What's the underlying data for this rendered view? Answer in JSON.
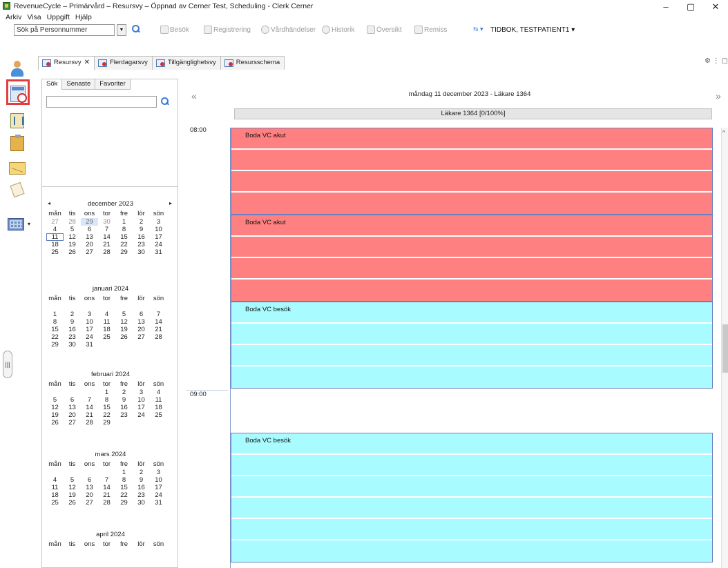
{
  "window": {
    "title": "RevenueCycle – Primärvård – Resursvy – Öppnad av Cerner Test, Scheduling - Clerk Cerner",
    "minimize": "–",
    "maximize": "▢",
    "close": "✕"
  },
  "menu": [
    "Arkiv",
    "Visa",
    "Uppgift",
    "Hjälp"
  ],
  "toolbar": {
    "search_placeholder": "Sök på Personnummer",
    "items": [
      "Besök",
      "Registrering",
      "Vårdhändelser",
      "Historik",
      "Översikt",
      "Remiss"
    ],
    "patient": "TIDBOK, TESTPATIENT1"
  },
  "tabs": [
    {
      "label": "Resursvy",
      "close": "✕"
    },
    {
      "label": "Flerdagarsvy"
    },
    {
      "label": "Tillgänglighetsvy"
    },
    {
      "label": "Resursschema"
    }
  ],
  "left_panel": {
    "subtabs": [
      "Sök",
      "Senaste",
      "Favoriter"
    ]
  },
  "calendar": {
    "weekdays": [
      "mån",
      "tis",
      "ons",
      "tor",
      "fre",
      "lör",
      "sön"
    ],
    "months": [
      {
        "title": "december 2023",
        "weeks": [
          [
            "27",
            "28",
            "29",
            "30",
            "1",
            "2",
            "3"
          ],
          [
            "4",
            "5",
            "6",
            "7",
            "8",
            "9",
            "10"
          ],
          [
            "11",
            "12",
            "13",
            "14",
            "15",
            "16",
            "17"
          ],
          [
            "18",
            "19",
            "20",
            "21",
            "22",
            "23",
            "24"
          ],
          [
            "25",
            "26",
            "27",
            "28",
            "29",
            "30",
            "31"
          ]
        ]
      },
      {
        "title": "januari 2024",
        "weeks": [
          [
            "",
            "",
            "",
            "",
            "",
            "",
            ""
          ],
          [
            "1",
            "2",
            "3",
            "4",
            "5",
            "6",
            "7"
          ],
          [
            "8",
            "9",
            "10",
            "11",
            "12",
            "13",
            "14"
          ],
          [
            "15",
            "16",
            "17",
            "18",
            "19",
            "20",
            "21"
          ],
          [
            "22",
            "23",
            "24",
            "25",
            "26",
            "27",
            "28"
          ],
          [
            "29",
            "30",
            "31",
            "",
            "",
            "",
            ""
          ]
        ]
      },
      {
        "title": "februari 2024",
        "weeks": [
          [
            "",
            "",
            "",
            "1",
            "2",
            "3",
            "4"
          ],
          [
            "5",
            "6",
            "7",
            "8",
            "9",
            "10",
            "11"
          ],
          [
            "12",
            "13",
            "14",
            "15",
            "16",
            "17",
            "18"
          ],
          [
            "19",
            "20",
            "21",
            "22",
            "23",
            "24",
            "25"
          ],
          [
            "26",
            "27",
            "28",
            "29",
            "",
            "",
            ""
          ]
        ]
      },
      {
        "title": "mars 2024",
        "weeks": [
          [
            "",
            "",
            "",
            "",
            "1",
            "2",
            "3"
          ],
          [
            "4",
            "5",
            "6",
            "7",
            "8",
            "9",
            "10"
          ],
          [
            "11",
            "12",
            "13",
            "14",
            "15",
            "16",
            "17"
          ],
          [
            "18",
            "19",
            "20",
            "21",
            "22",
            "23",
            "24"
          ],
          [
            "25",
            "26",
            "27",
            "28",
            "29",
            "30",
            "31"
          ]
        ]
      },
      {
        "title": "april 2024",
        "weeks": []
      }
    ]
  },
  "main": {
    "nav_prev": "«",
    "nav_next": "»",
    "day_title": "måndag 11 december 2023 - Läkare 1364",
    "resource": "Läkare 1364  [0/100%]",
    "times": [
      "08:00",
      "09:00"
    ],
    "blocks": [
      {
        "label": "Boda VC akut",
        "color": "#ff8080"
      },
      {
        "label": "Boda VC akut",
        "color": "#ff8080"
      },
      {
        "label": "Boda VC besök",
        "color": "#a8fbff"
      },
      {
        "label": "Boda VC besök",
        "color": "#a8fbff"
      }
    ]
  }
}
